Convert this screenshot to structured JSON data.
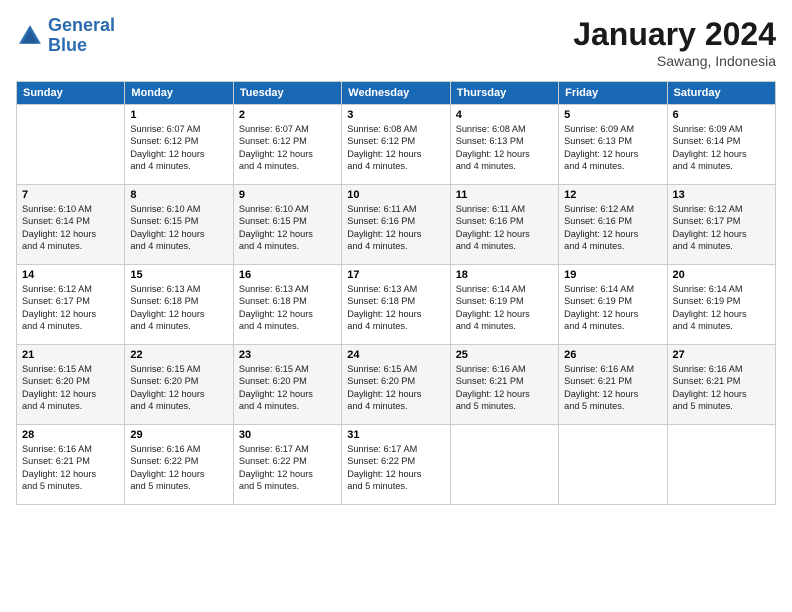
{
  "header": {
    "logo_line1": "General",
    "logo_line2": "Blue",
    "month": "January 2024",
    "location": "Sawang, Indonesia"
  },
  "weekdays": [
    "Sunday",
    "Monday",
    "Tuesday",
    "Wednesday",
    "Thursday",
    "Friday",
    "Saturday"
  ],
  "weeks": [
    [
      {
        "day": "",
        "info": ""
      },
      {
        "day": "1",
        "info": "Sunrise: 6:07 AM\nSunset: 6:12 PM\nDaylight: 12 hours\nand 4 minutes."
      },
      {
        "day": "2",
        "info": "Sunrise: 6:07 AM\nSunset: 6:12 PM\nDaylight: 12 hours\nand 4 minutes."
      },
      {
        "day": "3",
        "info": "Sunrise: 6:08 AM\nSunset: 6:12 PM\nDaylight: 12 hours\nand 4 minutes."
      },
      {
        "day": "4",
        "info": "Sunrise: 6:08 AM\nSunset: 6:13 PM\nDaylight: 12 hours\nand 4 minutes."
      },
      {
        "day": "5",
        "info": "Sunrise: 6:09 AM\nSunset: 6:13 PM\nDaylight: 12 hours\nand 4 minutes."
      },
      {
        "day": "6",
        "info": "Sunrise: 6:09 AM\nSunset: 6:14 PM\nDaylight: 12 hours\nand 4 minutes."
      }
    ],
    [
      {
        "day": "7",
        "info": "Sunrise: 6:10 AM\nSunset: 6:14 PM\nDaylight: 12 hours\nand 4 minutes."
      },
      {
        "day": "8",
        "info": "Sunrise: 6:10 AM\nSunset: 6:15 PM\nDaylight: 12 hours\nand 4 minutes."
      },
      {
        "day": "9",
        "info": "Sunrise: 6:10 AM\nSunset: 6:15 PM\nDaylight: 12 hours\nand 4 minutes."
      },
      {
        "day": "10",
        "info": "Sunrise: 6:11 AM\nSunset: 6:16 PM\nDaylight: 12 hours\nand 4 minutes."
      },
      {
        "day": "11",
        "info": "Sunrise: 6:11 AM\nSunset: 6:16 PM\nDaylight: 12 hours\nand 4 minutes."
      },
      {
        "day": "12",
        "info": "Sunrise: 6:12 AM\nSunset: 6:16 PM\nDaylight: 12 hours\nand 4 minutes."
      },
      {
        "day": "13",
        "info": "Sunrise: 6:12 AM\nSunset: 6:17 PM\nDaylight: 12 hours\nand 4 minutes."
      }
    ],
    [
      {
        "day": "14",
        "info": "Sunrise: 6:12 AM\nSunset: 6:17 PM\nDaylight: 12 hours\nand 4 minutes."
      },
      {
        "day": "15",
        "info": "Sunrise: 6:13 AM\nSunset: 6:18 PM\nDaylight: 12 hours\nand 4 minutes."
      },
      {
        "day": "16",
        "info": "Sunrise: 6:13 AM\nSunset: 6:18 PM\nDaylight: 12 hours\nand 4 minutes."
      },
      {
        "day": "17",
        "info": "Sunrise: 6:13 AM\nSunset: 6:18 PM\nDaylight: 12 hours\nand 4 minutes."
      },
      {
        "day": "18",
        "info": "Sunrise: 6:14 AM\nSunset: 6:19 PM\nDaylight: 12 hours\nand 4 minutes."
      },
      {
        "day": "19",
        "info": "Sunrise: 6:14 AM\nSunset: 6:19 PM\nDaylight: 12 hours\nand 4 minutes."
      },
      {
        "day": "20",
        "info": "Sunrise: 6:14 AM\nSunset: 6:19 PM\nDaylight: 12 hours\nand 4 minutes."
      }
    ],
    [
      {
        "day": "21",
        "info": "Sunrise: 6:15 AM\nSunset: 6:20 PM\nDaylight: 12 hours\nand 4 minutes."
      },
      {
        "day": "22",
        "info": "Sunrise: 6:15 AM\nSunset: 6:20 PM\nDaylight: 12 hours\nand 4 minutes."
      },
      {
        "day": "23",
        "info": "Sunrise: 6:15 AM\nSunset: 6:20 PM\nDaylight: 12 hours\nand 4 minutes."
      },
      {
        "day": "24",
        "info": "Sunrise: 6:15 AM\nSunset: 6:20 PM\nDaylight: 12 hours\nand 4 minutes."
      },
      {
        "day": "25",
        "info": "Sunrise: 6:16 AM\nSunset: 6:21 PM\nDaylight: 12 hours\nand 5 minutes."
      },
      {
        "day": "26",
        "info": "Sunrise: 6:16 AM\nSunset: 6:21 PM\nDaylight: 12 hours\nand 5 minutes."
      },
      {
        "day": "27",
        "info": "Sunrise: 6:16 AM\nSunset: 6:21 PM\nDaylight: 12 hours\nand 5 minutes."
      }
    ],
    [
      {
        "day": "28",
        "info": "Sunrise: 6:16 AM\nSunset: 6:21 PM\nDaylight: 12 hours\nand 5 minutes."
      },
      {
        "day": "29",
        "info": "Sunrise: 6:16 AM\nSunset: 6:22 PM\nDaylight: 12 hours\nand 5 minutes."
      },
      {
        "day": "30",
        "info": "Sunrise: 6:17 AM\nSunset: 6:22 PM\nDaylight: 12 hours\nand 5 minutes."
      },
      {
        "day": "31",
        "info": "Sunrise: 6:17 AM\nSunset: 6:22 PM\nDaylight: 12 hours\nand 5 minutes."
      },
      {
        "day": "",
        "info": ""
      },
      {
        "day": "",
        "info": ""
      },
      {
        "day": "",
        "info": ""
      }
    ]
  ]
}
